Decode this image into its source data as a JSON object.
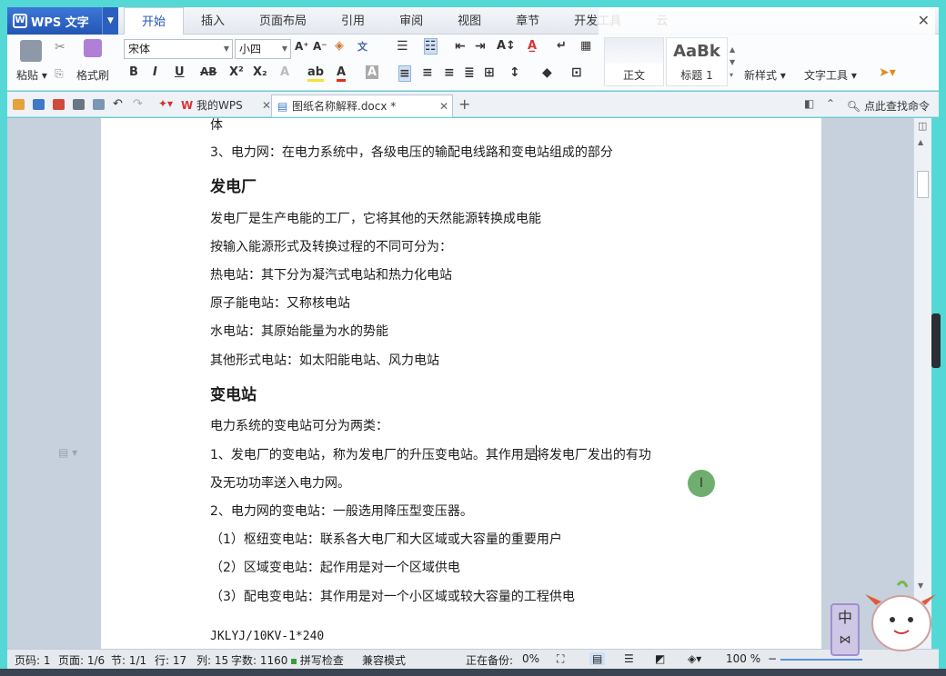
{
  "app": {
    "title": "WPS 文字"
  },
  "ribbon_tabs": [
    "开始",
    "插入",
    "页面布局",
    "引用",
    "审阅",
    "视图",
    "章节",
    "开发工具",
    "云"
  ],
  "toolbar": {
    "paste": "粘贴",
    "format_painter": "格式刷",
    "font": "宋体",
    "font_size": "小四",
    "style_normal": "正文",
    "style_heading1": "标题 1",
    "new_style": "新样式",
    "text_tools": "文字工具",
    "heading_preview": "AaBk"
  },
  "doc_tabs": {
    "mywps": "我的WPS",
    "current_doc": "图纸名称解释.docx *"
  },
  "quick": {
    "find_command": "点此查找命令"
  },
  "document": {
    "lines": [
      {
        "text": "体",
        "style": "normal"
      },
      {
        "text": "3、电力网：在电力系统中，各级电压的输配电线路和变电站组成的部分",
        "style": "normal"
      },
      {
        "text": "发电厂",
        "style": "heading"
      },
      {
        "text": "发电厂是生产电能的工厂，它将其他的天然能源转换成电能",
        "style": "normal"
      },
      {
        "text": "按输入能源形式及转换过程的不同可分为：",
        "style": "normal"
      },
      {
        "text": "热电站：其下分为凝汽式电站和热力化电站",
        "style": "normal"
      },
      {
        "text": "原子能电站：又称核电站",
        "style": "normal"
      },
      {
        "text": "水电站：其原始能量为水的势能",
        "style": "normal"
      },
      {
        "text": "其他形式电站：如太阳能电站、风力电站",
        "style": "normal"
      },
      {
        "text": "变电站",
        "style": "heading"
      },
      {
        "text": "电力系统的变电站可分为两类：",
        "style": "normal"
      },
      {
        "text": "1、发电厂的变电站，称为发电厂的升压变电站。其作用是将发电厂发出的有功",
        "style": "normal"
      },
      {
        "text": "及无功功率送入电力网。",
        "style": "normal"
      },
      {
        "text": "2、电力网的变电站：一般选用降压型变压器。",
        "style": "normal"
      },
      {
        "text": "（1）枢纽变电站：联系各大电厂和大区域或大容量的重要用户",
        "style": "normal"
      },
      {
        "text": "（2）区域变电站：起作用是对一个区域供电",
        "style": "normal"
      },
      {
        "text": "（3）配电变电站：其作用是对一个小区域或较大容量的工程供电",
        "style": "normal"
      },
      {
        "text": "JKLYJ/10KV-1*240",
        "style": "mono"
      }
    ],
    "cursor_glyph": "I"
  },
  "status": {
    "page_code": "页码: 1",
    "page": "页面: 1/6",
    "section": "节: 1/1",
    "row": "行: 17",
    "col": "列: 15",
    "word_count": "字数: 1160",
    "spell_check": "拼写检查",
    "compat_mode": "兼容模式",
    "backup": "正在备份:",
    "backup_pct": "0%",
    "zoom": "100 %"
  },
  "ime": {
    "label": "中"
  },
  "colors": {
    "accent": "#2456b4",
    "page_bg": "#c6d1dd",
    "frame": "#54d8d6"
  }
}
